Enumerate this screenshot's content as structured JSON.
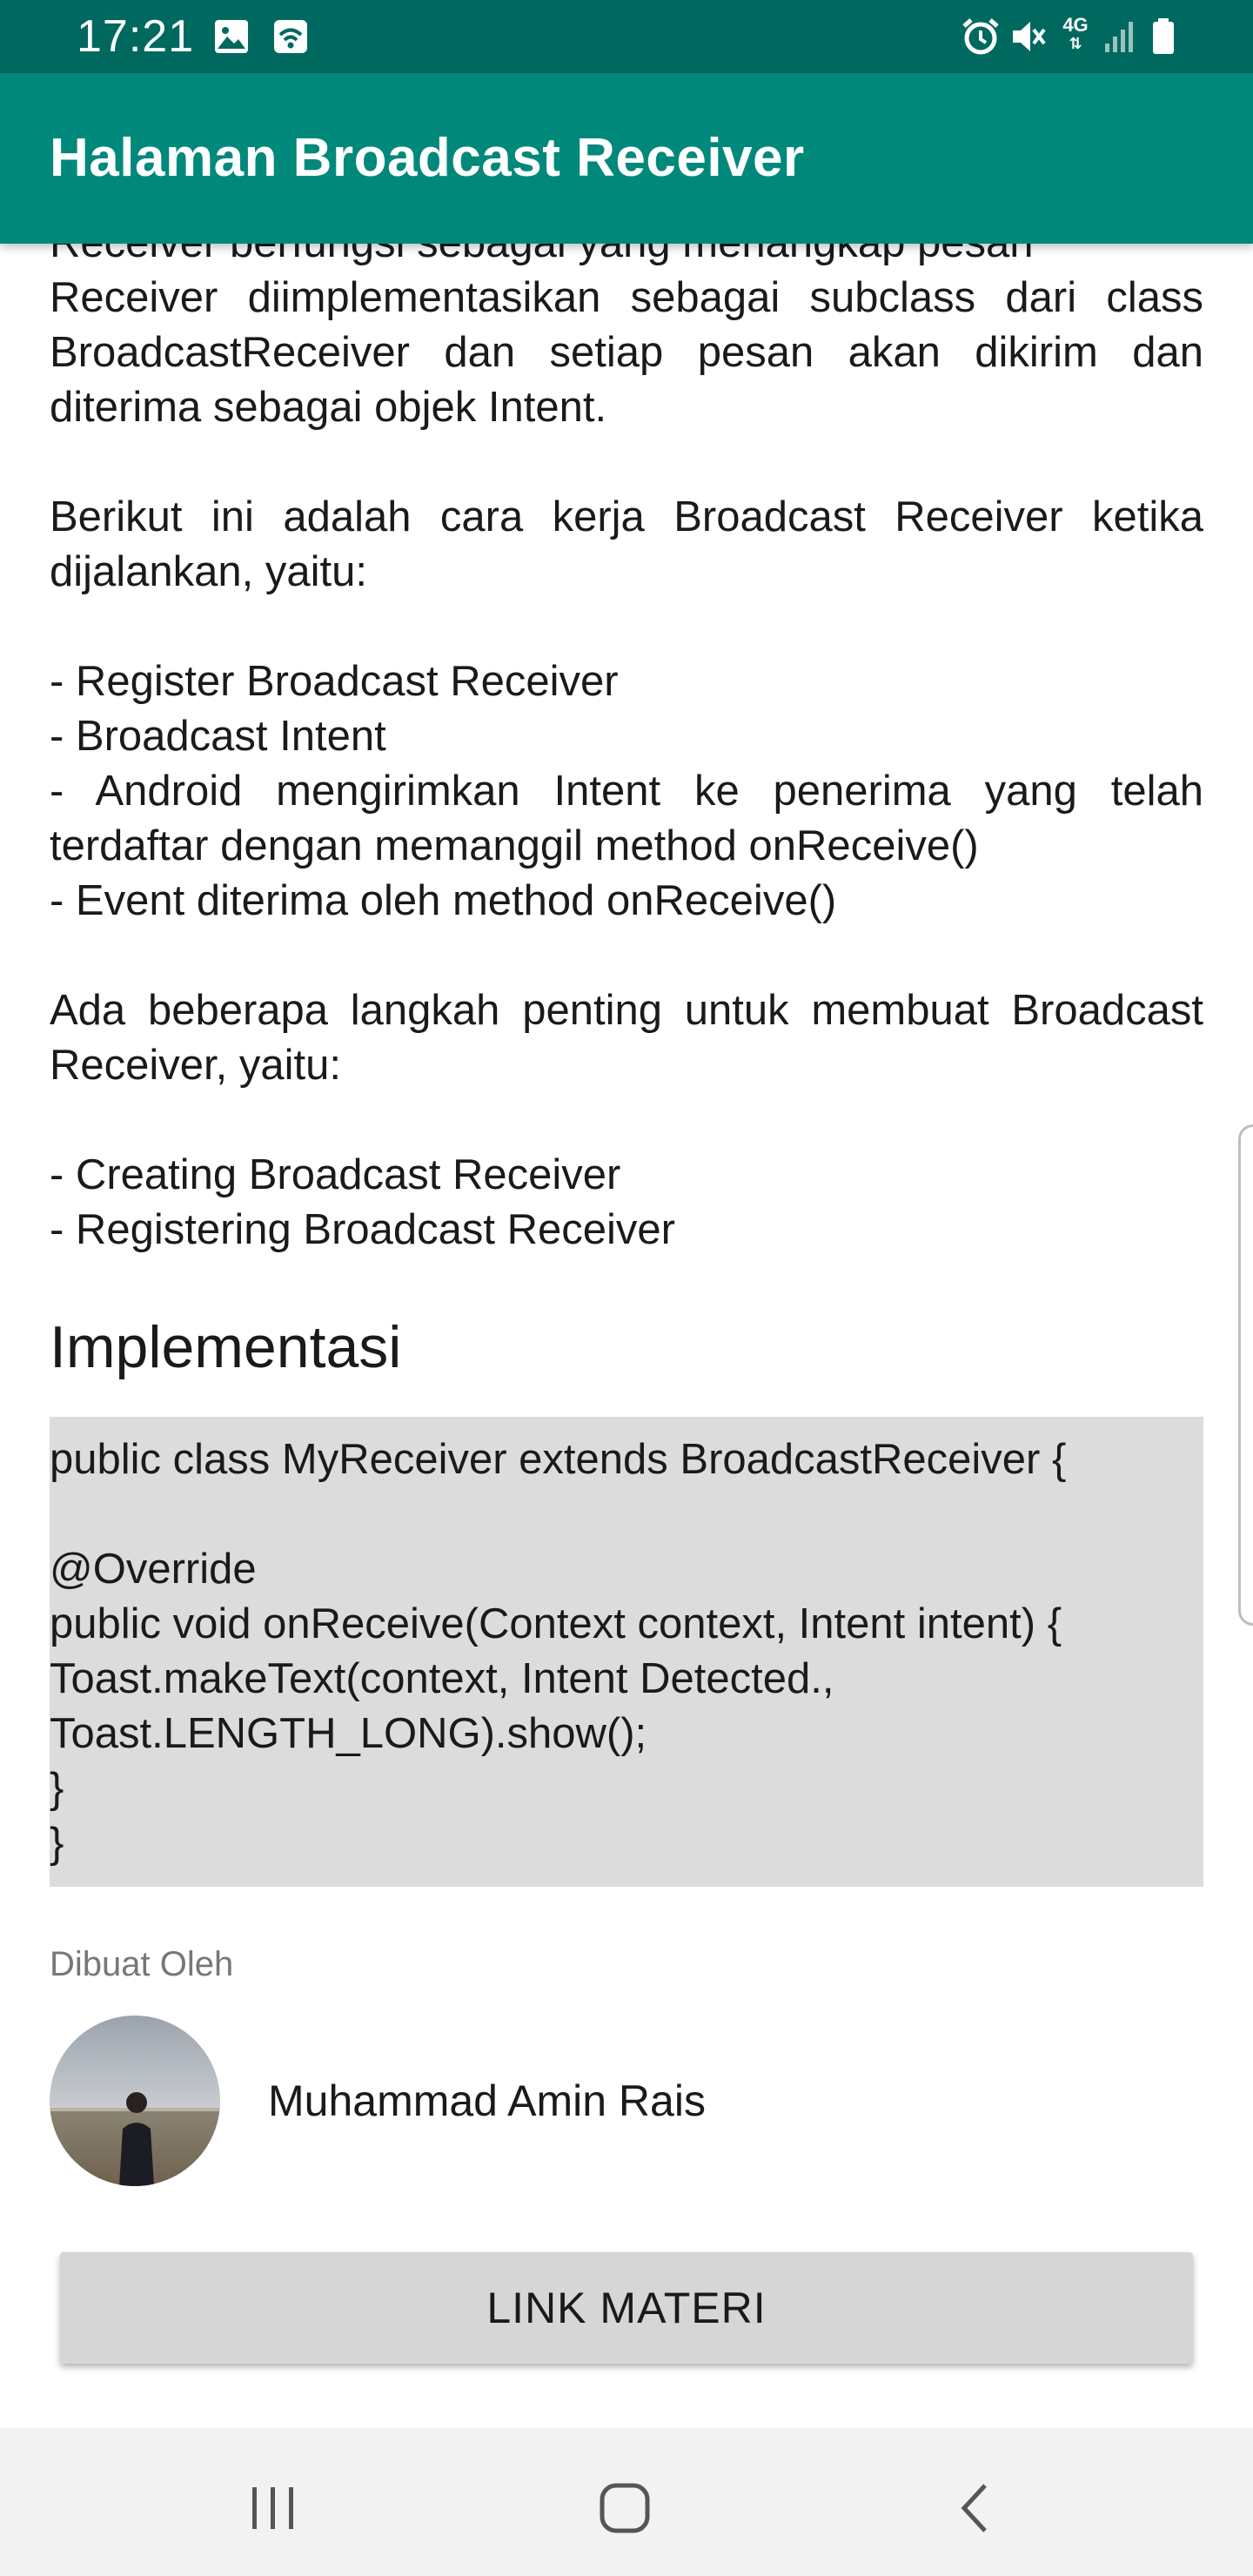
{
  "status_bar": {
    "time": "17:21",
    "network": "4G",
    "left_icons": [
      "image-icon",
      "wifi-calling-icon"
    ],
    "right_icons": [
      "alarm-icon",
      "mute-icon",
      "network-4g-icon",
      "signal-icon",
      "battery-icon"
    ]
  },
  "app_bar": {
    "title": "Halaman Broadcast Receiver",
    "color": "#00897b",
    "status_color": "#00695f"
  },
  "content": {
    "partial_top_line": "Receiver berfungsi sebagai yang menangkap pesan",
    "paragraphs": {
      "p1": "Receiver diimplementasikan sebagai subclass dari class BroadcastReceiver dan setiap pesan akan dikirim dan diterima sebagai objek Intent.",
      "p2": "Berikut ini adalah cara kerja Broadcast Receiver ketika dijalankan, yaitu:",
      "p3": "Ada beberapa langkah penting untuk membuat Broadcast Receiver, yaitu:"
    },
    "list1": [
      "- Register Broadcast Receiver",
      "- Broadcast Intent",
      "- Android mengirimkan Intent ke penerima yang telah terdaftar dengan memanggil method onReceive()",
      "- Event diterima oleh method onReceive()"
    ],
    "list2": [
      "- Creating Broadcast Receiver",
      "- Registering Broadcast Receiver"
    ],
    "section_title": "Implementasi",
    "code": "public class MyReceiver extends BroadcastReceiver {\n\n@Override\npublic void onReceive(Context context, Intent intent) {\nToast.makeText(context, Intent Detected.,\nToast.LENGTH_LONG).show();\n}\n}",
    "author_label": "Dibuat Oleh",
    "author_name": "Muhammad Amin Rais",
    "link_button": "LINK MATERI"
  },
  "nav_bar": {
    "buttons": [
      "recent-apps-icon",
      "home-icon",
      "back-icon"
    ]
  }
}
